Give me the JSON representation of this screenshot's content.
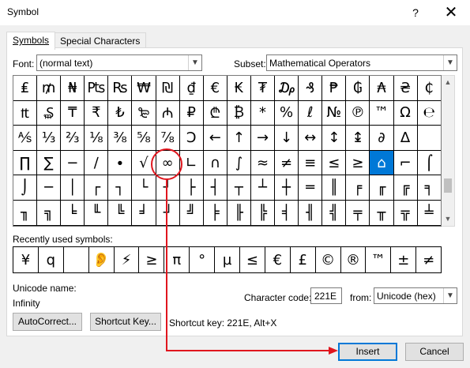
{
  "window": {
    "title": "Symbol",
    "help_glyph": "?",
    "close_glyph": "✕"
  },
  "tabs": [
    {
      "label": "Symbols",
      "active": true
    },
    {
      "label": "Special Characters",
      "active": false
    }
  ],
  "font": {
    "label": "Font:",
    "value": "(normal text)"
  },
  "subset": {
    "label": "Subset:",
    "value": "Mathematical Operators"
  },
  "symbol_grid": {
    "selected_index": 69,
    "cells": [
      "₤",
      "₥",
      "₦",
      "₧",
      "₨",
      "₩",
      "₪",
      "₫",
      "€",
      "₭",
      "₮",
      "₯",
      "₰",
      "₱",
      "₲",
      "₳",
      "₴",
      "₵",
      "₶",
      "₷",
      "₸",
      "₹",
      "₺",
      "₻",
      "₼",
      "₽",
      "₾",
      "₿",
      "*",
      "%",
      "ℓ",
      "№",
      "℗",
      "™",
      "Ω",
      "℮",
      "⅍",
      "⅓",
      "⅔",
      "⅛",
      "⅜",
      "⅝",
      "⅞",
      "Ↄ",
      "←",
      "↑",
      "→",
      "↓",
      "↔",
      "↕",
      "↨",
      "∂",
      "∆",
      "",
      "∏",
      "∑",
      "−",
      "∕",
      "∙",
      "√",
      "∞",
      "∟",
      "∩",
      "∫",
      "≈",
      "≠",
      "≡",
      "≤",
      "≥",
      "⌂",
      "⌐",
      "⌠",
      "⌡",
      "─",
      "│",
      "┌",
      "┐",
      "└",
      "┘",
      "├",
      "┤",
      "┬",
      "┴",
      "┼",
      "═",
      "║",
      "╒",
      "╓",
      "╔",
      "╕",
      "╖",
      "╗",
      "╘",
      "╙",
      "╚",
      "╛",
      "╜",
      "╝",
      "╞",
      "╟",
      "╠",
      "╡",
      "╢",
      "╣",
      "╤",
      "╥",
      "╦",
      "╧"
    ]
  },
  "recent": {
    "label": "Recently used symbols:",
    "symbols": [
      "¥",
      "q",
      "",
      "👂",
      "⚡",
      "≥",
      "π",
      "°",
      "µ",
      "≤",
      "€",
      "£",
      "©",
      "®",
      "™",
      "±",
      "≠",
      "÷"
    ]
  },
  "unicode_name": {
    "label": "Unicode name:",
    "value": "Infinity"
  },
  "character_code": {
    "label": "Character code:",
    "value": "221E"
  },
  "from": {
    "label": "from:",
    "value": "Unicode (hex)"
  },
  "shortcut_text": "Shortcut key: 221E, Alt+X",
  "buttons": {
    "autocorrect": "AutoCorrect...",
    "shortcut_key": "Shortcut Key...",
    "insert": "Insert",
    "cancel": "Cancel"
  },
  "annotation_color": "#e0161e",
  "accent_color": "#0078d7"
}
